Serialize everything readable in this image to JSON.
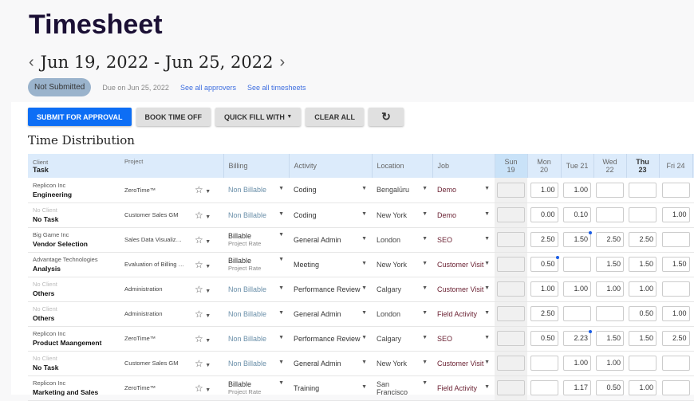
{
  "header": {
    "title": "Timesheet",
    "date_range": "Jun 19, 2022 - Jun 25, 2022",
    "status": "Not Submitted",
    "due": "Due on Jun 25, 2022",
    "approvers_link": "See all approvers",
    "timesheets_link": "See all timesheets"
  },
  "toolbar": {
    "submit": "SUBMIT FOR APPROVAL",
    "book": "BOOK TIME OFF",
    "quick": "QUICK FILL WITH",
    "clear": "CLEAR ALL",
    "refresh": "↻"
  },
  "section_title": "Time Distribution",
  "columns": {
    "client": "Client",
    "task": "Task",
    "project": "Project",
    "billing": "Billing",
    "activity": "Activity",
    "location": "Location",
    "job": "Job",
    "days": [
      "Sun 19",
      "Mon 20",
      "Tue 21",
      "Wed 22",
      "Thu 23",
      "Fri 24"
    ]
  },
  "rows": [
    {
      "client": "Replicon Inc",
      "task": "Engineering",
      "project": "ZeroTime™",
      "billing": "Non Billable",
      "rate": "",
      "activity": "Coding",
      "location": "Bengalūru",
      "job": "Demo",
      "hours": [
        "",
        "1.00",
        "1.00",
        "",
        "",
        ""
      ],
      "flag": []
    },
    {
      "client": "No Client",
      "task": "No Task",
      "project": "Customer Sales GM",
      "billing": "Non Billable",
      "rate": "",
      "activity": "Coding",
      "location": "New York",
      "job": "Demo",
      "hours": [
        "",
        "0.00",
        "0.10",
        "",
        "",
        "1.00"
      ],
      "flag": []
    },
    {
      "client": "Big Game Inc",
      "task": "Vendor Selection",
      "project": "Sales Data Visualization",
      "billing": "Billable",
      "rate": "Project Rate",
      "activity": "General Admin",
      "location": "London",
      "job": "SEO",
      "hours": [
        "",
        "2.50",
        "1.50",
        "2.50",
        "2.50",
        ""
      ],
      "flag": [
        2
      ]
    },
    {
      "client": "Advantage Technologies",
      "task": "Analysis",
      "project": "Evaluation of Billing Syst...",
      "billing": "Billable",
      "rate": "Project Rate",
      "activity": "Meeting",
      "location": "New York",
      "job": "Customer Visit",
      "hours": [
        "",
        "0.50",
        "",
        "1.50",
        "1.50",
        "1.50"
      ],
      "flag": [
        1
      ]
    },
    {
      "client": "No Client",
      "task": "Others",
      "project": "Administration",
      "billing": "Non Billable",
      "rate": "",
      "activity": "Performance Review",
      "location": "Calgary",
      "job": "Customer Visit",
      "hours": [
        "",
        "1.00",
        "1.00",
        "1.00",
        "1.00",
        ""
      ],
      "flag": []
    },
    {
      "client": "No Client",
      "task": "Others",
      "project": "Administration",
      "billing": "Non Billable",
      "rate": "",
      "activity": "General Admin",
      "location": "London",
      "job": "Field Activity",
      "hours": [
        "",
        "2.50",
        "",
        "",
        "0.50",
        "1.00"
      ],
      "flag": []
    },
    {
      "client": "Replicon Inc",
      "task": "Product Maangement",
      "project": "ZeroTime™",
      "billing": "Non Billable",
      "rate": "",
      "activity": "Performance Review",
      "location": "Calgary",
      "job": "SEO",
      "hours": [
        "",
        "0.50",
        "2.23",
        "1.50",
        "1.50",
        "2.50"
      ],
      "flag": [
        2
      ]
    },
    {
      "client": "No Client",
      "task": "No Task",
      "project": "Customer Sales GM",
      "billing": "Non Billable",
      "rate": "",
      "activity": "General Admin",
      "location": "New York",
      "job": "Customer Visit",
      "hours": [
        "",
        "",
        "1.00",
        "1.00",
        "",
        ""
      ],
      "flag": []
    },
    {
      "client": "Replicon Inc",
      "task": "Marketing and Sales",
      "project": "ZeroTime™",
      "billing": "Billable",
      "rate": "Project Rate",
      "activity": "Training",
      "location": "San Francisco",
      "job": "Field Activity",
      "hours": [
        "",
        "",
        "1.17",
        "0.50",
        "1.00",
        ""
      ],
      "flag": []
    }
  ]
}
